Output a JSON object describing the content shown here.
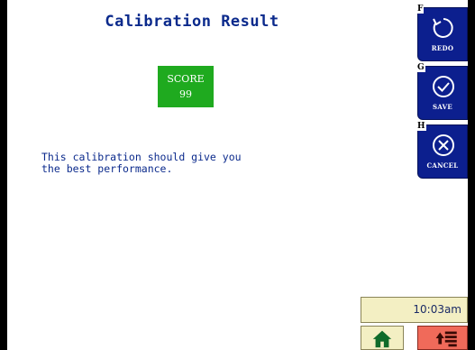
{
  "screen": {
    "title": "Calibration Result",
    "score": {
      "label": "SCORE",
      "value": "99"
    },
    "message": "This calibration should give you\nthe best performance."
  },
  "softkeys": [
    {
      "letter": "F",
      "label": "REDO",
      "icon": "redo-icon"
    },
    {
      "letter": "G",
      "label": "SAVE",
      "icon": "check-circle-icon"
    },
    {
      "letter": "H",
      "label": "CANCEL",
      "icon": "x-circle-icon"
    }
  ],
  "status": {
    "time": "10:03am"
  },
  "nav": {
    "home_icon": "home-icon",
    "menu_icon": "menu-icon"
  },
  "colors": {
    "accent": "#0c1f8e",
    "score_bg": "#1faa1f",
    "menu_bg": "#f06a5a"
  }
}
